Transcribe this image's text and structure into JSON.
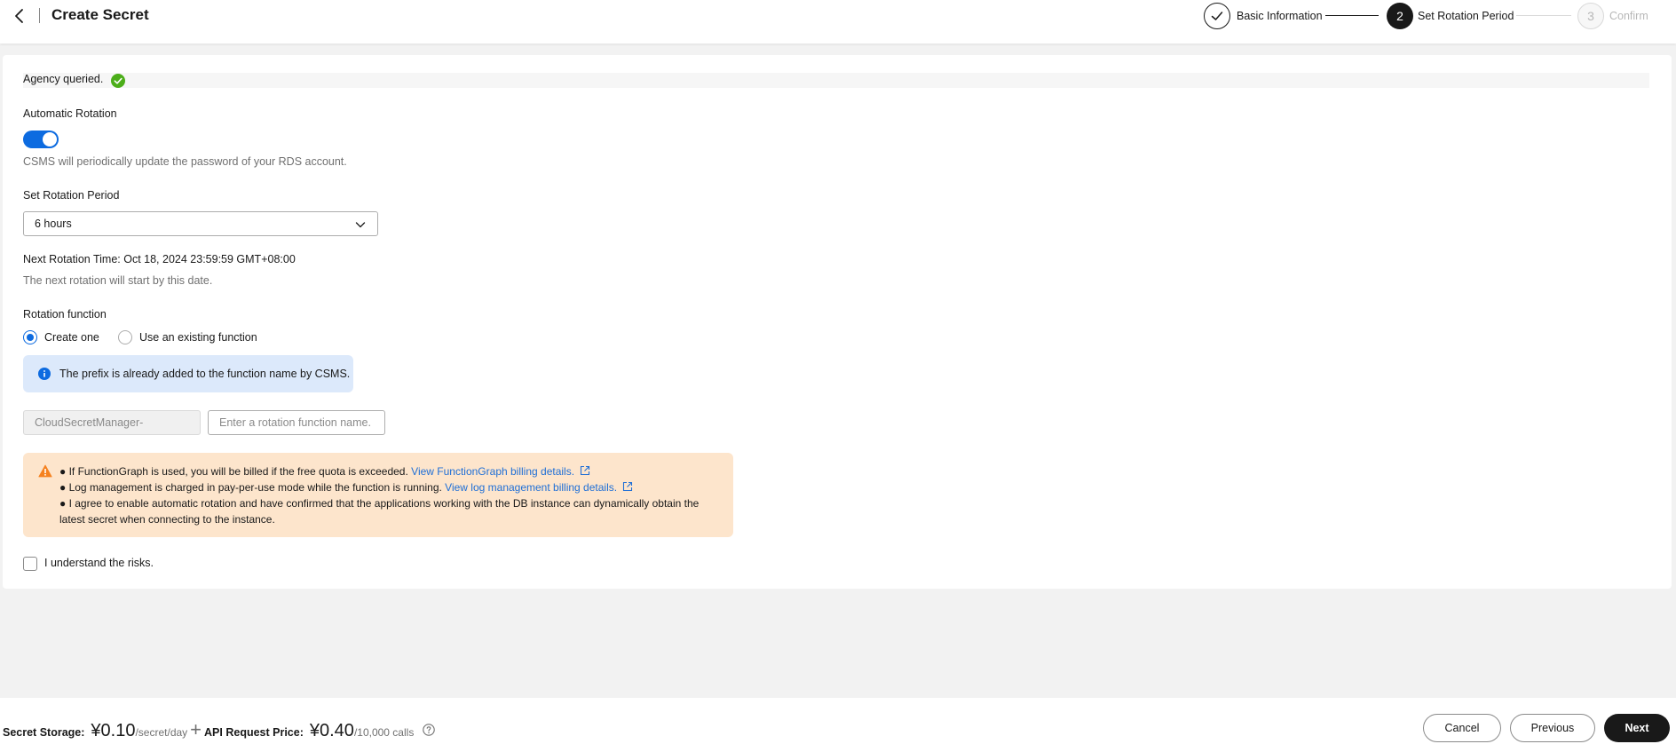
{
  "header": {
    "title": "Create Secret",
    "steps": [
      {
        "number": "",
        "label": "Basic Information",
        "state": "done"
      },
      {
        "number": "2",
        "label": "Set Rotation Period",
        "state": "active"
      },
      {
        "number": "3",
        "label": "Confirm",
        "state": "pending"
      }
    ]
  },
  "form": {
    "agency_text": "Agency queried.",
    "auto_rotation_label": "Automatic Rotation",
    "auto_rotation_enabled": true,
    "auto_rotation_hint": "CSMS will periodically update the password of your RDS account.",
    "period_label": "Set Rotation Period",
    "period_value": "6 hours",
    "next_rotation": "Next Rotation Time: Oct 18, 2024 23:59:59 GMT+08:00",
    "next_rotation_hint": "The next rotation will start by this date.",
    "function_label": "Rotation function",
    "function_options": [
      "Create one",
      "Use an existing function"
    ],
    "function_selected": "Create one",
    "info_text": "The prefix is already added to the function name by CSMS.",
    "prefix_value": "CloudSecretManager-",
    "name_placeholder": "Enter a rotation function name.",
    "warning": {
      "line1_text": "● If FunctionGraph is used, you will be billed if the free quota is exceeded.",
      "line1_link": "View FunctionGraph billing details.",
      "line2_text": "● Log management is charged in pay-per-use mode while the function is running.",
      "line2_link": "View log management billing details.",
      "line3_text": "● I agree to enable automatic rotation and have confirmed that the applications working with the DB instance can dynamically obtain the latest secret when connecting to the instance."
    },
    "risk_label": "I understand the risks.",
    "risk_checked": false
  },
  "footer": {
    "storage_label": "Secret Storage:",
    "storage_price": "¥0.10",
    "storage_unit": "/secret/day",
    "plus": "+",
    "api_label": "API Request Price:",
    "api_price": "¥0.40",
    "api_unit": "/10,000 calls",
    "cancel": "Cancel",
    "previous": "Previous",
    "next": "Next"
  },
  "colors": {
    "primary": "#0d6be0",
    "success": "#4cae1a",
    "warning": "#f58220",
    "link": "#1f6fd6",
    "dark_button": "#191919"
  }
}
